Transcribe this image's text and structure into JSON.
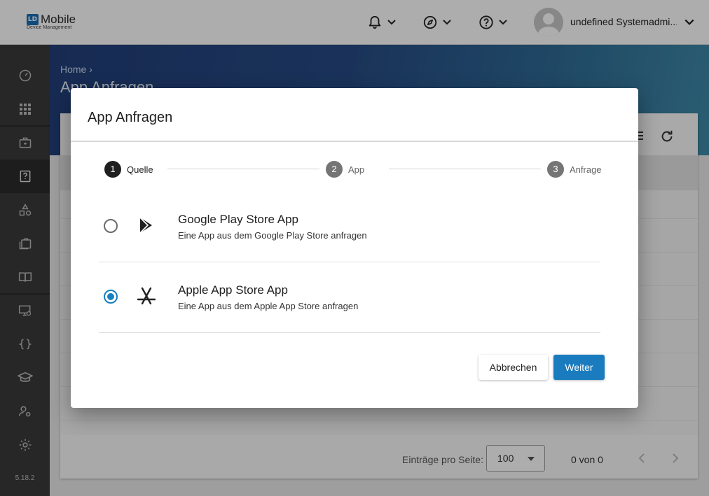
{
  "header": {
    "logo_badge": "LD",
    "logo_name": "Mobile",
    "logo_sub": "Device Management",
    "notifications_icon": "bell-icon",
    "compass_icon": "compass-icon",
    "help_icon": "help-circle-icon",
    "username": "undefined Systemadmi..."
  },
  "sidebar": {
    "items": [
      {
        "icon": "dashboard-gauge-icon"
      },
      {
        "icon": "apps-grid-icon"
      },
      {
        "icon": "briefcase-icon"
      },
      {
        "icon": "app-request-icon"
      },
      {
        "icon": "shapes-icon"
      },
      {
        "icon": "app-library-icon"
      },
      {
        "icon": "book-icon"
      },
      {
        "icon": "device-admin-icon"
      },
      {
        "icon": "code-braces-icon"
      },
      {
        "icon": "graduation-cap-icon"
      },
      {
        "icon": "user-settings-icon"
      },
      {
        "icon": "gear-icon"
      }
    ],
    "version": "5.18.2"
  },
  "page": {
    "breadcrumb": "Home",
    "title": "App Anfragen",
    "pagination": {
      "per_page_label": "Einträge pro Seite:",
      "per_page_value": "100",
      "range": "0 von 0"
    }
  },
  "dialog": {
    "title": "App Anfragen",
    "steps": [
      {
        "num": "1",
        "label": "Quelle",
        "active": true
      },
      {
        "num": "2",
        "label": "App",
        "active": false
      },
      {
        "num": "3",
        "label": "Anfrage",
        "active": false
      }
    ],
    "options": [
      {
        "title": "Google Play Store App",
        "description": "Eine App aus dem Google Play Store anfragen",
        "icon": "google-play-icon",
        "selected": false
      },
      {
        "title": "Apple App Store App",
        "description": "Eine App aus dem Apple App Store anfragen",
        "icon": "app-store-icon",
        "selected": true
      }
    ],
    "cancel_label": "Abbrechen",
    "next_label": "Weiter"
  },
  "colors": {
    "accent": "#1a7cbf",
    "sidebar": "#3a3a3a",
    "banner": "#274b84"
  }
}
